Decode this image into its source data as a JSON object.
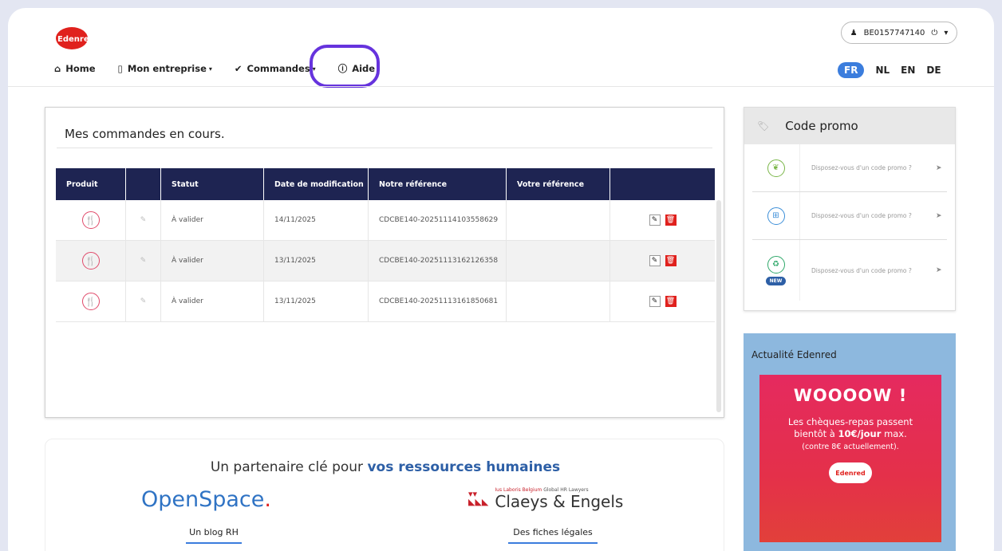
{
  "brand": {
    "logo_text": "Edenred"
  },
  "account": {
    "user": "BE0157747140",
    "user_icon": "user-icon",
    "power_icon": "power-icon",
    "caret": "▾"
  },
  "nav": {
    "home": "Home",
    "mon_entreprise": "Mon entreprise",
    "commandes": "Commandes",
    "aide": "Aide",
    "caret": "▾"
  },
  "languages": [
    "FR",
    "NL",
    "EN",
    "DE"
  ],
  "orders": {
    "title": "Mes commandes en cours.",
    "columns": [
      "Produit",
      "",
      "Statut",
      "Date de modification",
      "Notre référence",
      "Votre référence",
      ""
    ],
    "rows": [
      {
        "statut": "À valider",
        "date": "14/11/2025",
        "notre_ref": "CDCBE140-20251114103558629",
        "votre_ref": ""
      },
      {
        "statut": "À valider",
        "date": "13/11/2025",
        "notre_ref": "CDCBE140-20251113162126358",
        "votre_ref": ""
      },
      {
        "statut": "À valider",
        "date": "13/11/2025",
        "notre_ref": "CDCBE140-20251113161850681",
        "votre_ref": ""
      }
    ]
  },
  "partners": {
    "title_prefix": "Un partenaire clé pour",
    "title_highlight": "vos ressources humaines",
    "openspace": "OpenSpace",
    "openspace_dot": ".",
    "openspace_link": "Un blog RH",
    "claeys_small_red": "Ius Laboris Belgium",
    "claeys_small_rest": "Global HR Lawyers",
    "claeys_name": "Claeys & Engels",
    "claeys_link": "Des fiches légales"
  },
  "promo": {
    "title": "Code promo",
    "rows": [
      {
        "text": "Disposez-vous d'un code promo ?",
        "icon_color": "#7ab648",
        "new": false
      },
      {
        "text": "Disposez-vous d'un code promo ?",
        "icon_color": "#3b8ed8",
        "new": false
      },
      {
        "text": "Disposez-vous d'un code promo ?",
        "icon_color": "#2fa86a",
        "new": true,
        "new_label": "NEW"
      }
    ]
  },
  "news": {
    "title": "Actualité Edenred",
    "headline": "WOOOOW !",
    "line1": "Les chèques-repas passent",
    "line2_prefix": "bientôt à",
    "line2_bold": "10€/jour",
    "line2_suffix": "max.",
    "line3": "(contre 8€ actuellement).",
    "logo": "Edenred"
  },
  "colors": {
    "navy": "#1e2452",
    "accent_purple": "#6633dd",
    "red": "#e0211d",
    "blue": "#3b7ddd"
  }
}
